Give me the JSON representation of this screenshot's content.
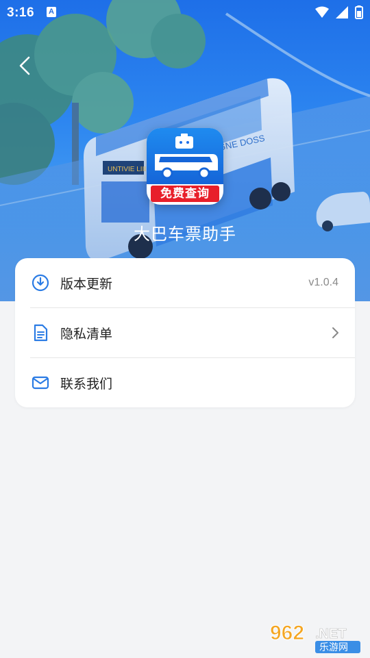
{
  "status_bar": {
    "time": "3:16",
    "notification_icon_letter": "A",
    "icons": [
      "wifi-icon",
      "signal-icon",
      "battery-icon"
    ]
  },
  "header": {
    "back_icon": "chevron-left-icon",
    "app_name": "大巴车票助手",
    "app_icon_badge": "免费查询",
    "hero_bus_signs": [
      "UNTIVIE LIII",
      "GNE DOSS"
    ]
  },
  "menu": {
    "items": [
      {
        "icon": "clock-download-icon",
        "label": "版本更新",
        "value": "v1.0.4"
      },
      {
        "icon": "document-icon",
        "label": "隐私清单",
        "chevron": "chevron-right-icon"
      },
      {
        "icon": "mail-icon",
        "label": "联系我们"
      }
    ]
  },
  "watermark": {
    "number": "962",
    "suffix": ".NET",
    "subtitle": "乐游网"
  },
  "colors": {
    "accent": "#1e6fe8",
    "icon_blue": "#2a7be4",
    "badge_red": "#e81f2a",
    "background": "#f3f4f6"
  }
}
